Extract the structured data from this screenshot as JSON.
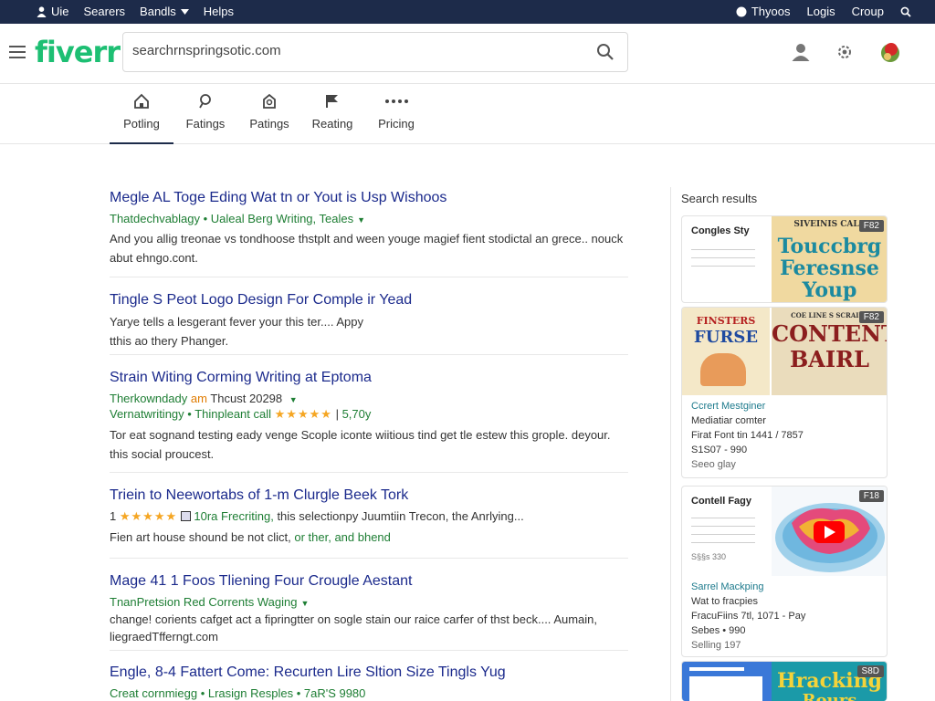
{
  "topbar": {
    "left": [
      "Uie",
      "Searers",
      "Bandls",
      "Helps"
    ],
    "right": [
      "Thyoos",
      "Logis",
      "Croup"
    ]
  },
  "header": {
    "logo": "fiverr",
    "search_value": "searchrnspringsotic.com"
  },
  "nav": {
    "tabs": [
      {
        "label": "Potling",
        "icon": "home-icon"
      },
      {
        "label": "Fatings",
        "icon": "search-icon"
      },
      {
        "label": "Patings",
        "icon": "bag-icon"
      },
      {
        "label": "Reating",
        "icon": "flag-icon"
      },
      {
        "label": "Pricing",
        "icon": "more-icon"
      }
    ],
    "active_index": 0
  },
  "results": [
    {
      "title": "Megle AL Toge Eding Wat tn or Yout is Usp Wishoos",
      "meta": "Thatdechvablagy  •  Ualeal Berg Writing, Teales",
      "desc": "And you allig treonae vs tondhoose thstplt and ween youge magief fient stodictal an grece.. nouck abut ehngo.cont."
    },
    {
      "title": "Tingle S Peot Logo Design For Comple ir Yead",
      "meta": "",
      "desc": "Yarye tells a lesgerant fever your this ter.... Appy tthis ao thery Phanger."
    },
    {
      "title": "Strain Witing Corming Writing at Eptoma",
      "meta_a": "Therkowndady",
      "meta_b": "am",
      "meta_c": "Thcust 20298",
      "meta2": "Vernatwritingy  •  Thinpleant call",
      "stars": "★★★★★",
      "rating": "5,70y",
      "desc": "Tor eat sognand testing eady venge Scople iconte wiitious tind get tle estew this grople. deyour. this social proucest."
    },
    {
      "title": "Triein to Neewortabs of 1-m Clurgle Beek Tork",
      "meta_num": "1",
      "stars": "★★★★★",
      "meta_green": "10ra Frecriting,",
      "meta_rest": "this selectionpy Juumtiin Trecon, the Anrlying...",
      "desc_a": "Fien art house shound be not clict,",
      "desc_b": "or ther, and bhend"
    },
    {
      "title": "Mage 41 1 Foos Tliening Four Crougle Aestant",
      "meta": "TnanPretsion Red Corrents Waging",
      "desc": "change! corients cafget act a fipringtter on sogle stain our raice carfer of thst beck.... Aumain, liegraedTfferngt.com"
    },
    {
      "title": "Engle, 8-4 Fattert Come: Recurten Lire Sltion Size Tingls Yug",
      "meta": "Creat cornmiegg  •  Lrasign Resples  •  7aR'S 9980",
      "desc": ""
    }
  ],
  "side": {
    "title": "Search results",
    "cards": [
      {
        "label": "Congles Sty",
        "badge": "F82",
        "thumb_lines": [
          "SIVEINIS CALE",
          "Touccbrg",
          "Feresnse",
          "Youp"
        ]
      },
      {
        "badge": "F82",
        "thumb_a": [
          "FINSTERS",
          "FURSE"
        ],
        "thumb_b": [
          "COE LINE S SCRAISE",
          "CONTENT",
          "BAIRL"
        ],
        "link": "Ccrert Mestginer",
        "lines": [
          "Mediatiar comter",
          "Firat Font tin 1441 / 7857",
          "S1S07 - 990"
        ],
        "more": "Seeo glay"
      },
      {
        "label": "Contell Fagy",
        "badge": "F18",
        "price": "S§§s 330",
        "link": "Sarrel Mackping",
        "lines": [
          "Wat to fracpies",
          "FracuFiins 7tl, 1071 - Pay",
          "Sebes • 990"
        ],
        "more": "Selling 197"
      },
      {
        "badge": "S8D",
        "thumb_lines": [
          "Hracking",
          "Rours"
        ]
      }
    ]
  }
}
